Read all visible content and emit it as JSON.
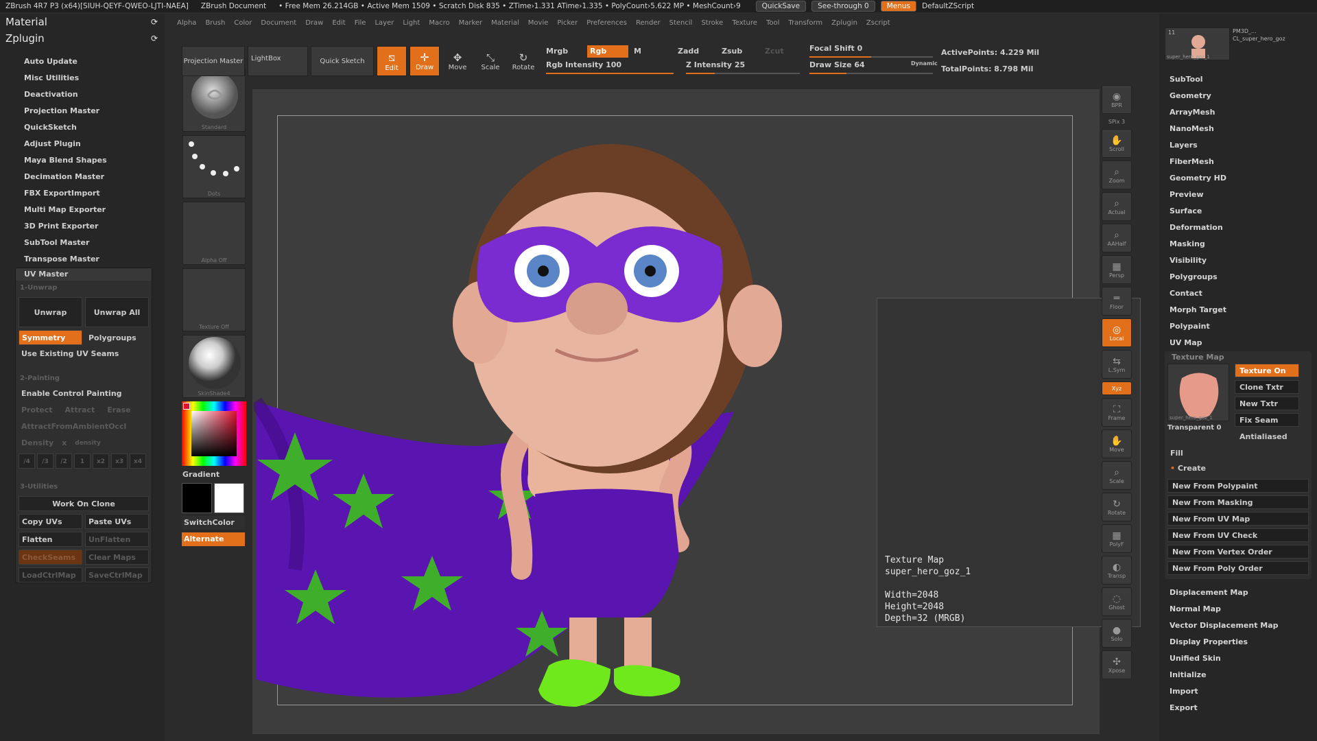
{
  "titlebar": {
    "app": "ZBrush 4R7 P3 (x64)[SIUH-QEYF-QWEO-LJTI-NAEA]",
    "doc": "ZBrush Document",
    "status": "• Free Mem 26.214GB • Active Mem 1509 • Scratch Disk 835 • ZTime›1.331 ATime›1.335 • PolyCount›5.622 MP • MeshCount›9",
    "quicksave": "QuickSave",
    "seethrough": "See-through  0",
    "menus": "Menus",
    "defaultzscript": "DefaultZScript"
  },
  "menubar": [
    "Alpha",
    "Brush",
    "Color",
    "Document",
    "Draw",
    "Edit",
    "File",
    "Layer",
    "Light",
    "Macro",
    "Marker",
    "Material",
    "Movie",
    "Picker",
    "Preferences",
    "Render",
    "Stencil",
    "Stroke",
    "Texture",
    "Tool",
    "Transform",
    "Zplugin",
    "Zscript"
  ],
  "leftpanel": {
    "material": "Material",
    "zplugin": "Zplugin",
    "items": [
      "Auto Update",
      "Misc Utilities",
      "Deactivation",
      "Projection Master",
      "QuickSketch",
      "Adjust Plugin",
      "Maya Blend Shapes",
      "Decimation Master",
      "FBX ExportImport",
      "Multi Map Exporter",
      "3D Print Exporter",
      "SubTool Master",
      "Transpose Master"
    ],
    "uv": {
      "title": "UV Master",
      "unwrap_section": "1-Unwrap",
      "unwrap": "Unwrap",
      "unwrap_all": "Unwrap All",
      "symmetry": "Symmetry",
      "polygroups": "Polygroups",
      "use_seams": "Use Existing UV Seams",
      "painting_section": "2-Painting",
      "enable_control": "Enable Control Painting",
      "protect": "Protect",
      "attract": "Attract",
      "erase": "Erase",
      "attract_ao": "AttractFromAmbientOccl",
      "density": "Density",
      "density_x": "x",
      "density_val": "density",
      "density_btns": [
        "/4",
        "/3",
        "/2",
        "1",
        "x2",
        "x3",
        "x4"
      ],
      "utilities_section": "3-Utilities",
      "work_on_clone": "Work On Clone",
      "copy_uvs": "Copy UVs",
      "paste_uvs": "Paste UVs",
      "flatten": "Flatten",
      "unflatten": "UnFlatten",
      "checkseams": "CheckSeams",
      "clear_maps": "Clear Maps",
      "load_ctrl": "LoadCtrlMap",
      "save_ctrl": "SaveCtrlMap"
    }
  },
  "brushcol": {
    "standard": "Standard",
    "dots": "Dots",
    "alpha": "Alpha Off",
    "texture": "Texture Off",
    "material": "SkinShade4",
    "gradient": "Gradient",
    "switchcolor": "SwitchColor",
    "alternate": "Alternate"
  },
  "toolbar": {
    "projection_master": "Projection Master",
    "lightbox": "LightBox",
    "quick_sketch": "Quick Sketch",
    "edit": "Edit",
    "draw": "Draw",
    "move": "Move",
    "scale": "Scale",
    "rotate": "Rotate",
    "mrgb": "Mrgb",
    "rgb": "Rgb",
    "m": "M",
    "zadd": "Zadd",
    "zsub": "Zsub",
    "zcut": "Zcut",
    "rgb_intensity": "Rgb Intensity 100",
    "z_intensity": "Z Intensity 25",
    "focal_shift": "Focal Shift 0",
    "draw_size": "Draw Size 64",
    "dynamic": "Dynamic",
    "active_points": "ActivePoints: 4.229 Mil",
    "total_points": "TotalPoints: 8.798 Mil",
    "rgb_intensity_pct": 100,
    "z_intensity_pct": 25,
    "focal_shift_pct": 50,
    "draw_size_pct": 30
  },
  "shelf": [
    "BPR",
    "SPix 3",
    "Scroll",
    "Zoom",
    "Actual",
    "AAHalf",
    "Persp",
    "Floor",
    "Local",
    "L.Sym",
    "Xyz",
    "Frame",
    "Move",
    "Scale",
    "Rotate",
    "PolyF",
    "Transp",
    "Ghost",
    "Solo",
    "Xpose"
  ],
  "rightpanel": {
    "tool_thumb_1": "PM3D_...",
    "tool_thumb_2": "CL_super_hero_goz",
    "tool_thumb_3": "super_hero_goz_1",
    "tool_count": "11",
    "items": [
      "SubTool",
      "Geometry",
      "ArrayMesh",
      "NanoMesh",
      "Layers",
      "FiberMesh",
      "Geometry HD",
      "Preview",
      "Surface",
      "Deformation",
      "Masking",
      "Visibility",
      "Polygroups",
      "Contact",
      "Morph Target",
      "Polypaint",
      "UV Map"
    ],
    "texture_map": "Texture Map",
    "texture_on": "Texture On",
    "clone_txtr": "Clone Txtr",
    "new_txtr": "New Txtr",
    "fix_seam": "Fix Seam",
    "transparent": "Transparent 0",
    "antialiased": "Antialiased",
    "tex_thumb_label": "super_hero_goz_1",
    "fill": "Fill",
    "create": "Create",
    "create_items": [
      "New From Polypaint",
      "New From Masking",
      "New From UV Map",
      "New From UV Check",
      "New From Vertex Order",
      "New From Poly Order"
    ],
    "items_after": [
      "Displacement Map",
      "Normal Map",
      "Vector Displacement Map",
      "Display Properties",
      "Unified Skin",
      "Initialize",
      "Import",
      "Export"
    ]
  },
  "infobox": {
    "line1": "Texture Map",
    "line2": "super_hero_goz_1",
    "line3": "Width=2048",
    "line4": "Height=2048",
    "line5": "Depth=32 (MRGB)"
  }
}
